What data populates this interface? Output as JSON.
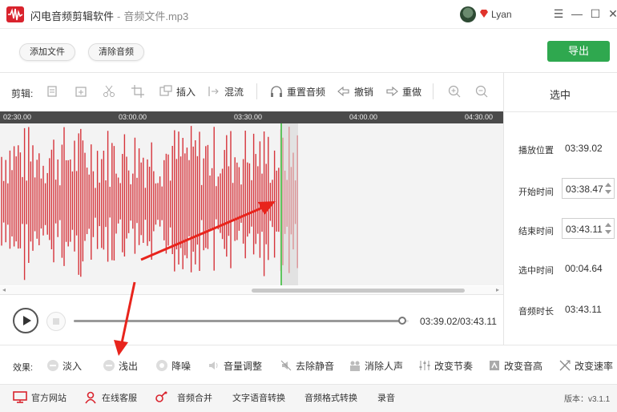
{
  "window": {
    "app_name": "闪电音频剪辑软件",
    "separator": "-",
    "file_name": "音频文件.mp3",
    "username": "Lyan",
    "min_glyph": "—",
    "max_glyph": "☐",
    "close_glyph": "✕",
    "menu_glyph": "☰"
  },
  "toolbar": {
    "add_file": "添加文件",
    "clear_audio": "清除音频",
    "export": "导出"
  },
  "edit_bar": {
    "label": "剪辑:",
    "insert": "插入",
    "mix": "混流",
    "reset_audio": "重置音频",
    "undo": "撤销",
    "redo": "重做"
  },
  "waveform": {
    "ruler_ticks": [
      "02:30.00",
      "03:00.00",
      "03:30.00",
      "04:00.00",
      "04:30.00"
    ],
    "wave_color": "#d6333a",
    "cursor_color": "#5ec55e"
  },
  "playback": {
    "time": "03:39.02/03:43.11",
    "progress": 0.98
  },
  "panel": {
    "title": "选中",
    "play_pos_label": "播放位置",
    "play_pos_value": "03:39.02",
    "start_label": "开始时间",
    "start_value": "03:38.47",
    "end_label": "结束时间",
    "end_value": "03:43.11",
    "sel_label": "选中时间",
    "sel_value": "00:04.64",
    "dur_label": "音频时长",
    "dur_value": "03:43.11"
  },
  "effects": {
    "label": "效果:",
    "fade_in": "淡入",
    "fade_out": "浅出",
    "denoise": "降噪",
    "volume": "音量调整",
    "remove_silence": "去除静音",
    "remove_vocal": "消除人声",
    "tempo": "改变节奏",
    "pitch": "改变音高",
    "speed": "改变速率"
  },
  "bottom": {
    "website": "官方网站",
    "support": "在线客服",
    "merge": "音频合并",
    "tts": "文字语音转换",
    "convert": "音频格式转换",
    "record": "录音",
    "version": "版本：v3.1.1"
  },
  "colors": {
    "accent_red": "#d9232d",
    "export_green": "#2fa84f",
    "annotation_red": "#e8241c"
  }
}
